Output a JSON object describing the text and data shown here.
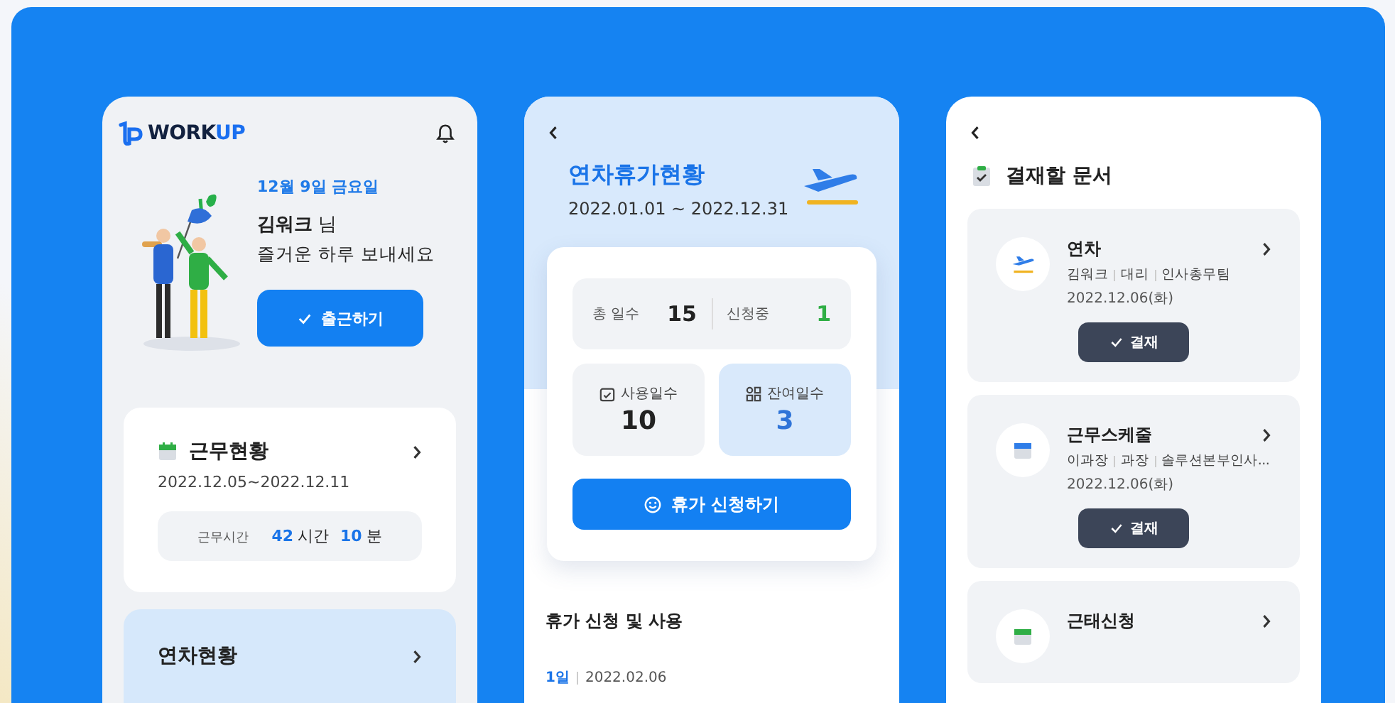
{
  "home": {
    "logo": {
      "main": "WORK",
      "accent": "UP"
    },
    "date": "12월 9일 금요일",
    "name": "김워크",
    "honorific": "님",
    "greeting": "즐거운 하루 보내세요",
    "checkin_button": "출근하기",
    "work_card": {
      "title": "근무현황",
      "range": "2022.12.05~2022.12.11",
      "label": "근무시간",
      "hours": "42",
      "hours_unit": "시간",
      "minutes": "10",
      "minutes_unit": "분"
    },
    "leave_card": {
      "title": "연차현황"
    }
  },
  "leave": {
    "title": "연차휴가현황",
    "range": "2022.01.01 ~ 2022.12.31",
    "summary": [
      {
        "label": "총 일수",
        "value": "15",
        "kind": "total"
      },
      {
        "label": "신청중",
        "value": "1",
        "kind": "pending"
      }
    ],
    "tiles": [
      {
        "label": "사용일수",
        "value": "10",
        "kind": "used"
      },
      {
        "label": "잔여일수",
        "value": "3",
        "kind": "remaining"
      }
    ],
    "apply_button": "휴가 신청하기",
    "section_title": "휴가 신청 및 사용",
    "history": [
      {
        "days": "1일",
        "date": "2022.02.06"
      }
    ]
  },
  "approvals": {
    "title": "결재할 문서",
    "docs": [
      {
        "kind": "vacation",
        "title": "연차",
        "meta": [
          "김워크",
          "대리",
          "인사총무팀"
        ],
        "date": "2022.12.06(화)",
        "button": "결재"
      },
      {
        "kind": "schedule",
        "title": "근무스케줄",
        "meta": [
          "이과장",
          "과장",
          "솔루션본부인사..."
        ],
        "date": "2022.12.06(화)",
        "button": "결재"
      },
      {
        "kind": "attendance",
        "title": "근태신청"
      }
    ]
  }
}
